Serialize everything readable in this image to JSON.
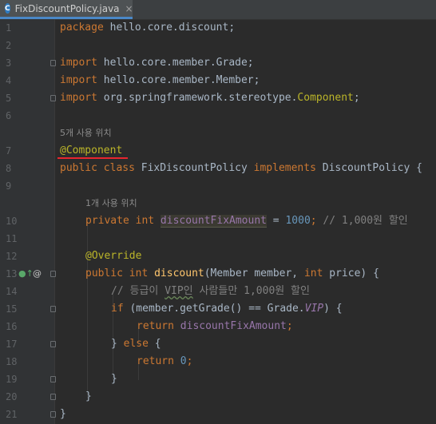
{
  "tab": {
    "icon_letter": "C",
    "filename": "FixDiscountPolicy.java",
    "close": "×"
  },
  "gutter_icons": {
    "implementation_marker": "●↑",
    "override_marker": "@"
  },
  "lines": [
    {
      "n": "1"
    },
    {
      "n": "2"
    },
    {
      "n": "3"
    },
    {
      "n": "4"
    },
    {
      "n": "5"
    },
    {
      "n": "6"
    },
    {
      "n": "7"
    },
    {
      "n": "8"
    },
    {
      "n": "9"
    },
    {
      "n": "10"
    },
    {
      "n": "11"
    },
    {
      "n": "12"
    },
    {
      "n": "13"
    },
    {
      "n": "14"
    },
    {
      "n": "15"
    },
    {
      "n": "16"
    },
    {
      "n": "17"
    },
    {
      "n": "18"
    },
    {
      "n": "19"
    },
    {
      "n": "20"
    },
    {
      "n": "21"
    }
  ],
  "code": {
    "l1_kw": "package",
    "l1_rest": " hello.core.discount;",
    "l3_kw": "import",
    "l3_rest": " hello.core.member.Grade;",
    "l4_kw": "import",
    "l4_rest": " hello.core.member.Member;",
    "l5_kw": "import",
    "l5_rest": " org.springframework.stereotype.",
    "l5_ann": "Component",
    "l5_end": ";",
    "hint_usages_class": "5개 사용 위치",
    "l7_ann": "@Component",
    "l8_kw": "public class",
    "l8_name": " FixDiscountPolicy ",
    "l8_impl": "implements",
    "l8_iface": " DiscountPolicy {",
    "hint_usages_field": "1개 사용 위치",
    "l10_kw": "private int",
    "l10_field": "discountFixAmount",
    "l10_eq": " = ",
    "l10_num": "1000",
    "l10_semi": ";",
    "l10_cmt": " // 1,000원 할인",
    "l12_ann": "@Override",
    "l13_kw": "public int",
    "l13_method": "discount",
    "l13_params1": "(Member member, ",
    "l13_int": "int",
    "l13_params2": " price) {",
    "l14_cmt_a": "// 등급이 ",
    "l14_cmt_vip": "VIP인",
    "l14_cmt_b": " 사람들만 1,000원 할인",
    "l15_if": "if",
    "l15_rest": " (member.getGrade() == Grade.",
    "l15_vip": "VIP",
    "l15_end": ") {",
    "l16_ret": "return",
    "l16_field": "discountFixAmount",
    "l16_end": ";",
    "l17_brace": "} ",
    "l17_else": "else",
    "l17_end": " {",
    "l18_ret": "return",
    "l18_num": "0",
    "l18_end": ";",
    "l19": "}",
    "l20": "}",
    "l21": "}"
  }
}
